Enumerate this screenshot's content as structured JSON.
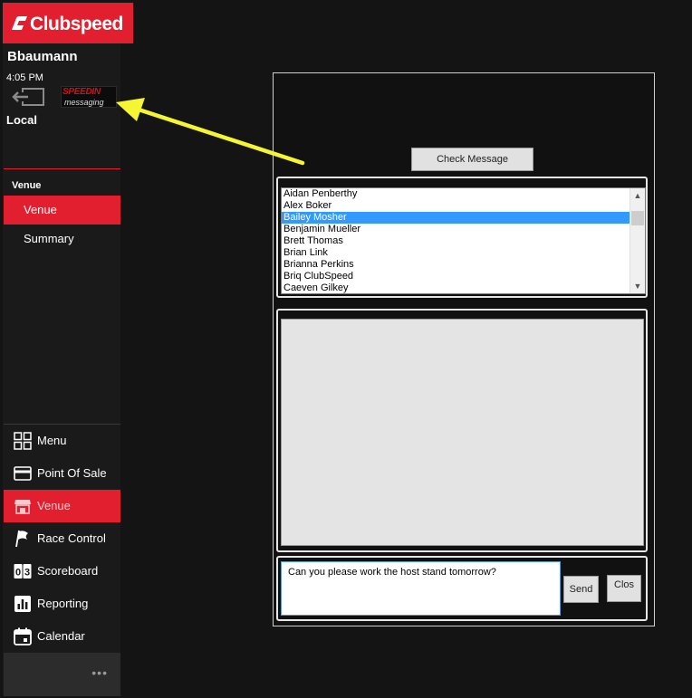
{
  "brand": {
    "name": "Clubspeed",
    "color": "#e21f2e"
  },
  "user": {
    "name": "Bbaumann",
    "time": "4:05 PM",
    "location": "Local"
  },
  "speedin": {
    "line1": "SPEEDIN",
    "line2": "messaging"
  },
  "venue_section": {
    "heading": "Venue",
    "items": [
      {
        "label": "Venue",
        "active": true
      },
      {
        "label": "Summary",
        "active": false
      }
    ]
  },
  "nav": {
    "items": [
      {
        "label": "Menu",
        "icon": "grid-icon"
      },
      {
        "label": "Point Of Sale",
        "icon": "card-icon"
      },
      {
        "label": "Venue",
        "icon": "store-icon",
        "active": true
      },
      {
        "label": "Race Control",
        "icon": "flag-icon"
      },
      {
        "label": "Scoreboard",
        "icon": "scoreboard-icon"
      },
      {
        "label": "Reporting",
        "icon": "chart-icon"
      },
      {
        "label": "Calendar",
        "icon": "calendar-icon"
      }
    ],
    "more": "•••"
  },
  "messaging": {
    "check_button": "Check Message",
    "recipients": [
      "Aidan Penberthy",
      "Alex Boker",
      "Bailey Mosher",
      "Benjamin Mueller",
      "Brett Thomas",
      "Brian Link",
      "Brianna Perkins",
      "Briq ClubSpeed",
      "Caeven Gilkey"
    ],
    "selected_recipient": "Bailey Mosher",
    "compose_text": "Can you please work the host stand tomorrow?",
    "send_button": "Send",
    "close_button": "Clos"
  },
  "annotation": {
    "arrow_color": "#f5f532"
  }
}
